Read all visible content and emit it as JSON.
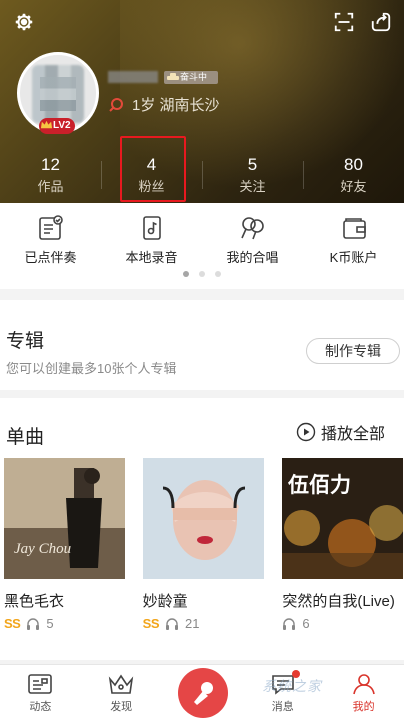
{
  "profile": {
    "age_location": "1岁 湖南长沙",
    "level_badge": "LV2",
    "vip_badge": "奋斗中"
  },
  "stats": [
    {
      "value": "12",
      "label": "作品"
    },
    {
      "value": "4",
      "label": "粉丝"
    },
    {
      "value": "5",
      "label": "关注"
    },
    {
      "value": "80",
      "label": "好友"
    }
  ],
  "quick_actions": [
    {
      "label": "已点伴奏",
      "icon": "ordered-accompaniment-icon"
    },
    {
      "label": "本地录音",
      "icon": "local-recording-icon"
    },
    {
      "label": "我的合唱",
      "icon": "chorus-icon"
    },
    {
      "label": "K币账户",
      "icon": "wallet-icon"
    }
  ],
  "pager": {
    "count": 3,
    "active": 0
  },
  "album": {
    "title": "专辑",
    "subtitle": "您可以创建最多10张个人专辑",
    "create_button": "制作专辑"
  },
  "singles": {
    "title": "单曲",
    "play_all": "播放全部",
    "songs": [
      {
        "name": "黑色毛衣",
        "rating": "SS",
        "listens": "5",
        "cover_text": "Jay Chou"
      },
      {
        "name": "妙龄童",
        "rating": "SS",
        "listens": "21",
        "cover_text": ""
      },
      {
        "name": "突然的自我(Live)",
        "rating": "",
        "listens": "6",
        "cover_text": "伍佰力"
      }
    ]
  },
  "bottom_nav": [
    {
      "label": "动态",
      "icon": "feed-icon"
    },
    {
      "label": "发现",
      "icon": "discover-crown-icon"
    },
    {
      "label": "",
      "icon": "microphone-icon"
    },
    {
      "label": "消息",
      "icon": "message-icon"
    },
    {
      "label": "我的",
      "icon": "profile-icon"
    }
  ],
  "watermark": "系统之家",
  "colors": {
    "accent": "#e54646",
    "highlight": "#e8191f",
    "rating": "#f2a51a",
    "header": "#4d3f17"
  }
}
